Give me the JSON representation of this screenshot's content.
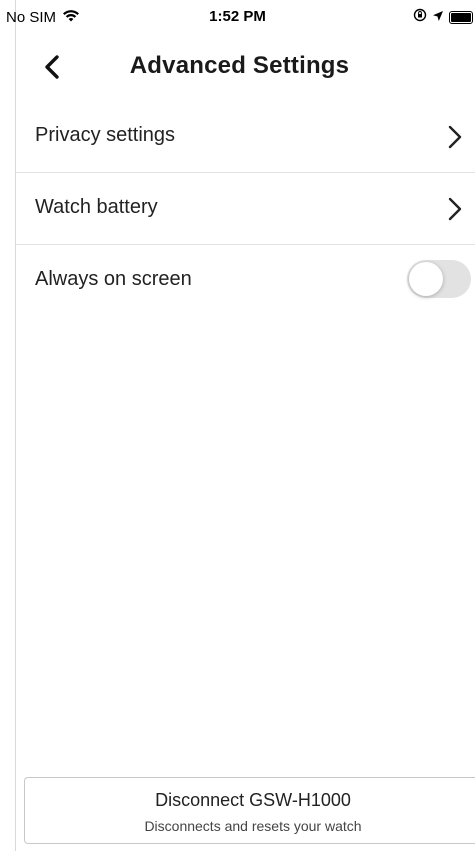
{
  "status_bar": {
    "carrier": "No SIM",
    "time": "1:52 PM"
  },
  "header": {
    "title": "Advanced Settings"
  },
  "settings": {
    "items": [
      {
        "label": "Privacy settings"
      },
      {
        "label": "Watch battery"
      },
      {
        "label": "Always on screen",
        "toggle_on": false
      }
    ]
  },
  "footer": {
    "disconnect_label": "Disconnect GSW-H1000",
    "disconnect_sub": "Disconnects and resets your watch"
  }
}
